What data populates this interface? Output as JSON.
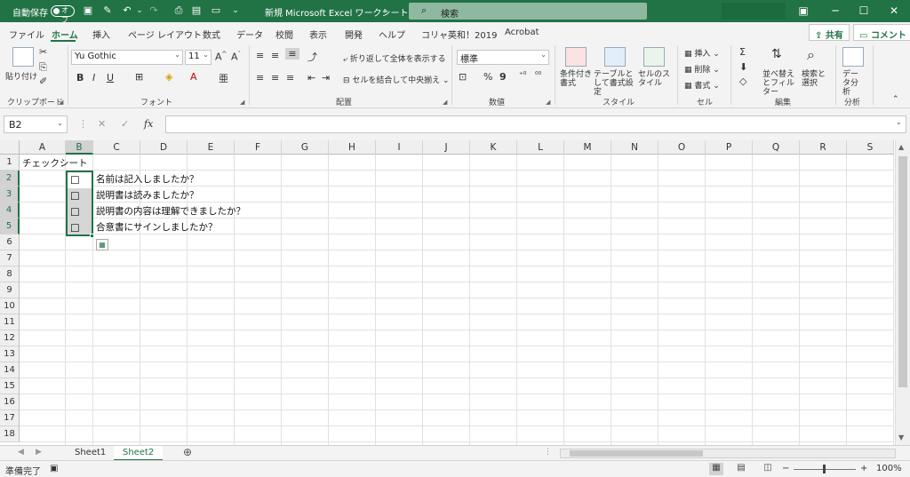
{
  "titlebar": {
    "autosave_label": "自動保存",
    "autosave_state": "オフ",
    "doc_title": "新規 Microsoft Excel ワークシート",
    "doc_title_caret": "⌄",
    "search_placeholder": "検索"
  },
  "menu": {
    "tabs": [
      "ファイル",
      "ホーム",
      "挿入",
      "ページ レイアウト",
      "数式",
      "データ",
      "校閲",
      "表示",
      "開発",
      "ヘルプ",
      "コリャ英和！2019",
      "Acrobat"
    ],
    "share_label": "共有",
    "comment_label": "コメント"
  },
  "ribbon": {
    "clipboard": {
      "paste": "貼り付け",
      "group": "クリップボード"
    },
    "font": {
      "name": "Yu Gothic",
      "size": "11",
      "group": "フォント",
      "bold": "B",
      "italic": "I",
      "underline": "U",
      "grow": "A^",
      "shrink": "Aˇ"
    },
    "alignment": {
      "wrap": "折り返して全体を表示する",
      "merge": "セルを結合して中央揃え",
      "group": "配置"
    },
    "number": {
      "format": "標準",
      "group": "数値"
    },
    "styles": {
      "conditional": "条件付き書式",
      "table": "テーブルとして書式設定",
      "cell": "セルのスタイル",
      "group": "スタイル"
    },
    "cells": {
      "insert": "挿入",
      "delete": "削除",
      "format": "書式",
      "group": "セル"
    },
    "editing": {
      "sort": "並べ替えとフィルター",
      "find": "検索と選択",
      "group": "編集"
    },
    "analysis": {
      "analyze": "データ分析",
      "group": "分析"
    }
  },
  "formulabar": {
    "namebox": "B2",
    "fx": "fx",
    "value": ""
  },
  "grid": {
    "columns": [
      "A",
      "B",
      "C",
      "D",
      "E",
      "F",
      "G",
      "H",
      "I",
      "J",
      "K",
      "L",
      "M",
      "N",
      "O",
      "P",
      "Q",
      "R",
      "S"
    ],
    "rows": [
      "1",
      "2",
      "3",
      "4",
      "5",
      "6",
      "7",
      "8",
      "9",
      "10",
      "11",
      "12",
      "13",
      "14",
      "15",
      "16",
      "17",
      "18"
    ],
    "cells": {
      "A1": "チェックシート",
      "C2": "名前は記入しましたか？",
      "C3": "説明書は読みましたか？",
      "C4": "説明書の内容は理解できましたか？",
      "C5": "合意書にサインしましたか？"
    },
    "checkbox_glyph": "☐",
    "selected_cell": "B2",
    "selected_range": "B2:B5"
  },
  "sheets": {
    "tabs": [
      "Sheet1",
      "Sheet2"
    ],
    "active": "Sheet2",
    "add": "⊕"
  },
  "status": {
    "ready": "準備完了",
    "zoom": "100%",
    "zoom_minus": "−",
    "zoom_plus": "+"
  },
  "colors": {
    "accent": "#217346",
    "selection": "#d6d6d6"
  }
}
